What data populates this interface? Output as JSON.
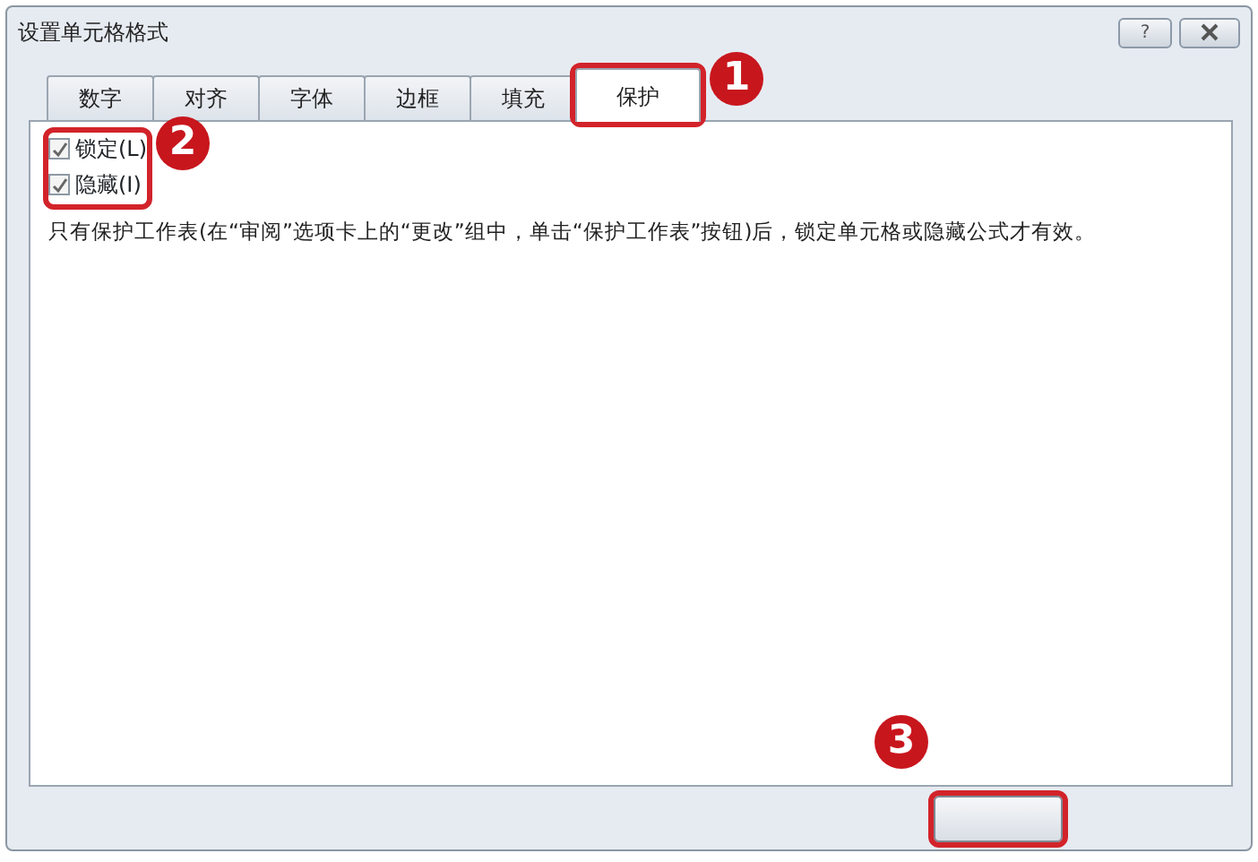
{
  "window": {
    "title": "设置单元格格式",
    "help_button": "?"
  },
  "tabs": [
    {
      "label": "数字",
      "selected": false
    },
    {
      "label": "对齐",
      "selected": false
    },
    {
      "label": "字体",
      "selected": false
    },
    {
      "label": "边框",
      "selected": false
    },
    {
      "label": "填充",
      "selected": false
    },
    {
      "label": "保护",
      "selected": true
    }
  ],
  "checkboxes": [
    {
      "label": "锁定(L)",
      "checked": true
    },
    {
      "label": "隐藏(I)",
      "checked": true
    }
  ],
  "note": "只有保护工作表(在“审阅”选项卡上的“更改”组中，单击“保护工作表”按钮)后，锁定单元格或隐藏公式才有效。",
  "callouts": [
    {
      "label": "1"
    },
    {
      "label": "2"
    },
    {
      "label": "3"
    }
  ]
}
